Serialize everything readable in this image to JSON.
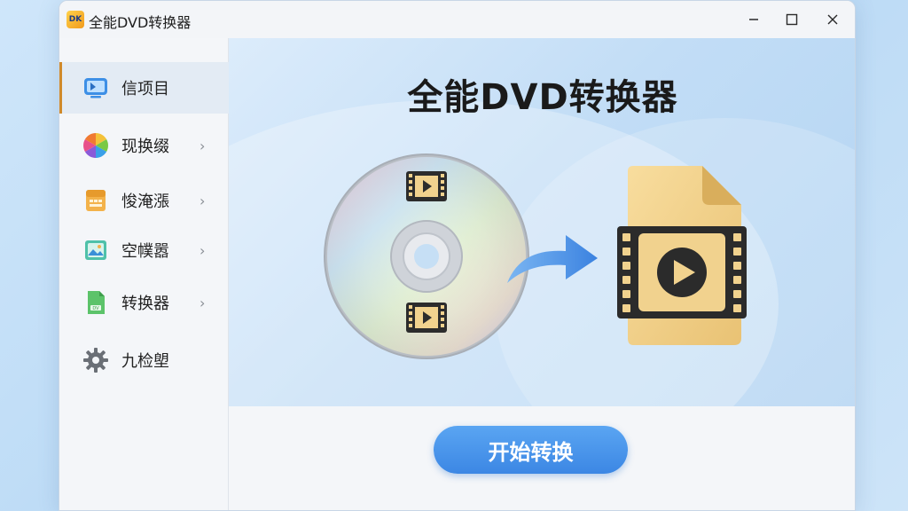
{
  "window": {
    "title": "全能DVD转换器",
    "app_icon_text": "DK",
    "controls": {
      "minimize_icon": "minimize-icon",
      "maximize_icon": "maximize-icon",
      "close_icon": "close-icon"
    }
  },
  "sidebar": {
    "items": [
      {
        "label": "信项目",
        "icon": "monitor-icon",
        "active": true,
        "has_chevron": false
      },
      {
        "label": "现换缀",
        "icon": "color-wheel-icon",
        "active": false,
        "has_chevron": true
      },
      {
        "label": "悛淹漲",
        "icon": "archive-box-icon",
        "active": false,
        "has_chevron": true
      },
      {
        "label": "空幞嚣",
        "icon": "image-file-icon",
        "active": false,
        "has_chevron": true
      },
      {
        "label": "转换器",
        "icon": "document-icon",
        "active": false,
        "has_chevron": true
      },
      {
        "label": "九检塱",
        "icon": "gear-icon",
        "active": false,
        "has_chevron": false
      }
    ]
  },
  "hero": {
    "title": "全能DVD转换器"
  },
  "actions": {
    "start_label": "开始转换"
  },
  "colors": {
    "accent": "#3c87e4",
    "active_marker": "#d08a2b",
    "file_gold": "#f1d28e"
  }
}
